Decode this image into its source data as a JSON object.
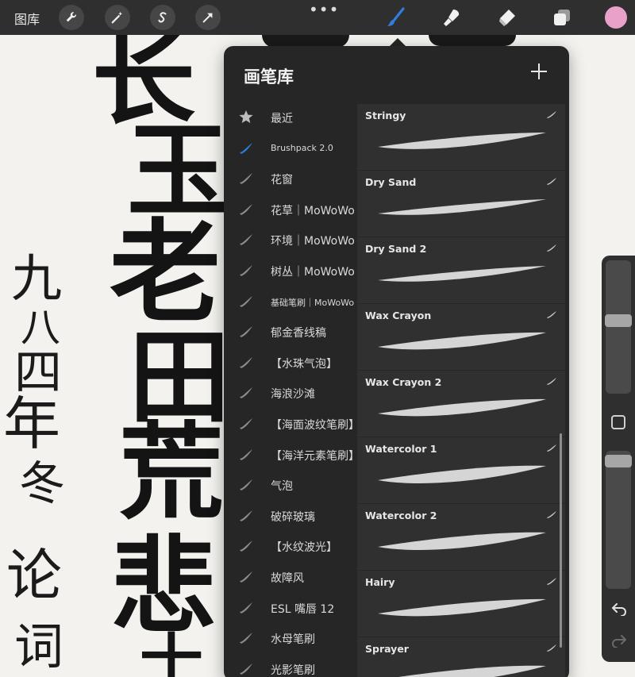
{
  "topbar": {
    "gallery_label": "图库",
    "tools_left": [
      "wrench-icon",
      "magic-wand-icon",
      "selection-s-icon",
      "transform-arrow-icon"
    ],
    "tools_right": [
      "brush-icon",
      "smudge-icon",
      "eraser-icon",
      "layers-icon"
    ],
    "active_color": "#e9a1c9",
    "accent_color": "#2f7de1"
  },
  "canvas": {
    "large_text": [
      "长",
      "玉",
      "老",
      "田",
      "荒",
      "悲",
      "士"
    ],
    "small_text": [
      "九",
      "八",
      "四",
      "年",
      "冬",
      "论",
      "词"
    ]
  },
  "brush_library": {
    "title": "画笔库",
    "sets": [
      {
        "label": "最近",
        "icon": "star-icon"
      },
      {
        "label": "Brushpack 2.0",
        "icon": "brush-set-icon",
        "active": true
      },
      {
        "label": "花窗",
        "icon": "brush-set-icon"
      },
      {
        "label": "花草｜MoWoWo",
        "icon": "brush-set-icon"
      },
      {
        "label": "环境｜MoWoWo",
        "icon": "brush-set-icon"
      },
      {
        "label": "树丛｜MoWoWo",
        "icon": "brush-set-icon"
      },
      {
        "label": "基础笔刷｜MoWoWo",
        "icon": "brush-set-icon"
      },
      {
        "label": "郁金香线稿",
        "icon": "brush-set-icon"
      },
      {
        "label": "【水珠气泡】",
        "icon": "brush-set-icon"
      },
      {
        "label": "海浪沙滩",
        "icon": "brush-set-icon"
      },
      {
        "label": "【海面波纹笔刷】",
        "icon": "brush-set-icon"
      },
      {
        "label": "【海洋元素笔刷】",
        "icon": "brush-set-icon"
      },
      {
        "label": "气泡",
        "icon": "brush-set-icon"
      },
      {
        "label": "破碎玻璃",
        "icon": "brush-set-icon"
      },
      {
        "label": "【水纹波光】",
        "icon": "brush-set-icon"
      },
      {
        "label": "故障风",
        "icon": "brush-set-icon"
      },
      {
        "label": "ESL 嘴唇 12",
        "icon": "brush-set-icon"
      },
      {
        "label": "水母笔刷",
        "icon": "brush-set-icon"
      },
      {
        "label": "光影笔刷",
        "icon": "brush-set-icon"
      }
    ],
    "brushes": [
      {
        "name": "Stringy"
      },
      {
        "name": "Dry Sand"
      },
      {
        "name": "Dry Sand 2"
      },
      {
        "name": "Wax Crayon"
      },
      {
        "name": "Wax Crayon 2"
      },
      {
        "name": "Watercolor 1"
      },
      {
        "name": "Watercolor 2"
      },
      {
        "name": "Hairy"
      },
      {
        "name": "Sprayer"
      }
    ]
  },
  "sidebar": {
    "size_level": 0.55,
    "opacity_level": 0.97
  }
}
